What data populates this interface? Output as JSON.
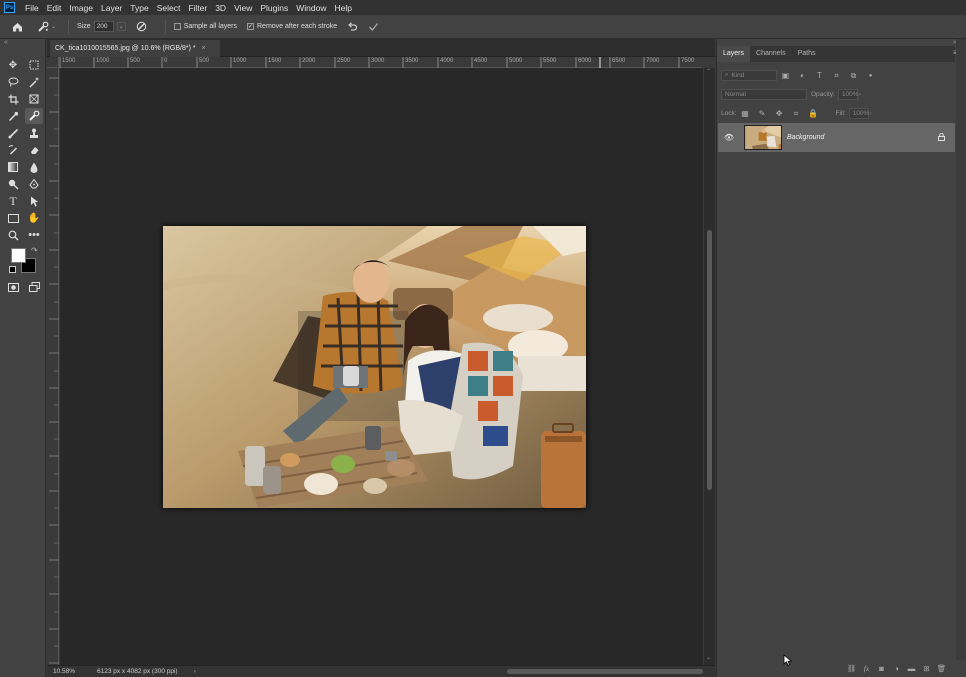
{
  "app": {
    "logo": "Ps"
  },
  "menu": [
    "File",
    "Edit",
    "Image",
    "Layer",
    "Type",
    "Select",
    "Filter",
    "3D",
    "View",
    "Plugins",
    "Window",
    "Help"
  ],
  "options": {
    "home_icon": "home-icon",
    "tool_icon": "spot-healing-brush-icon",
    "size_label": "Size",
    "size_value": "200",
    "sample_all_layers": "Sample all layers",
    "remove_after_stroke": "Remove after each stroke",
    "undo_icon": "undo-icon",
    "commit_icon": "checkmark-icon"
  },
  "document": {
    "tab_title": "CK_tica1010015565.jpg @ 10.6% (RGB/8*) *",
    "close": "×"
  },
  "ruler": {
    "labels": [
      "1500",
      "1000",
      "500",
      "0",
      "500",
      "1000",
      "1500",
      "2000",
      "2500",
      "3000",
      "3500",
      "4000",
      "4500",
      "5000",
      "5500",
      "6000",
      "6500",
      "7000",
      "7500"
    ]
  },
  "status": {
    "zoom": "10.58%",
    "doc_info": "6123 px x 4082 px (300 ppi)",
    "arrow": "›"
  },
  "panel": {
    "tabs": [
      "Layers",
      "Channels",
      "Paths"
    ],
    "kind_placeholder": "Kind",
    "blend_mode": "Normal",
    "opacity_label": "Opacity:",
    "opacity_value": "100%",
    "lock_label": "Lock:",
    "fill_label": "Fill:",
    "fill_value": "100%",
    "layers": [
      {
        "name": "Background",
        "visible": true,
        "locked": true
      }
    ]
  },
  "colors": {
    "accent": "#31a8ff",
    "panel_bg": "#424242",
    "canvas_bg": "#282828",
    "selected_layer": "#666666"
  }
}
